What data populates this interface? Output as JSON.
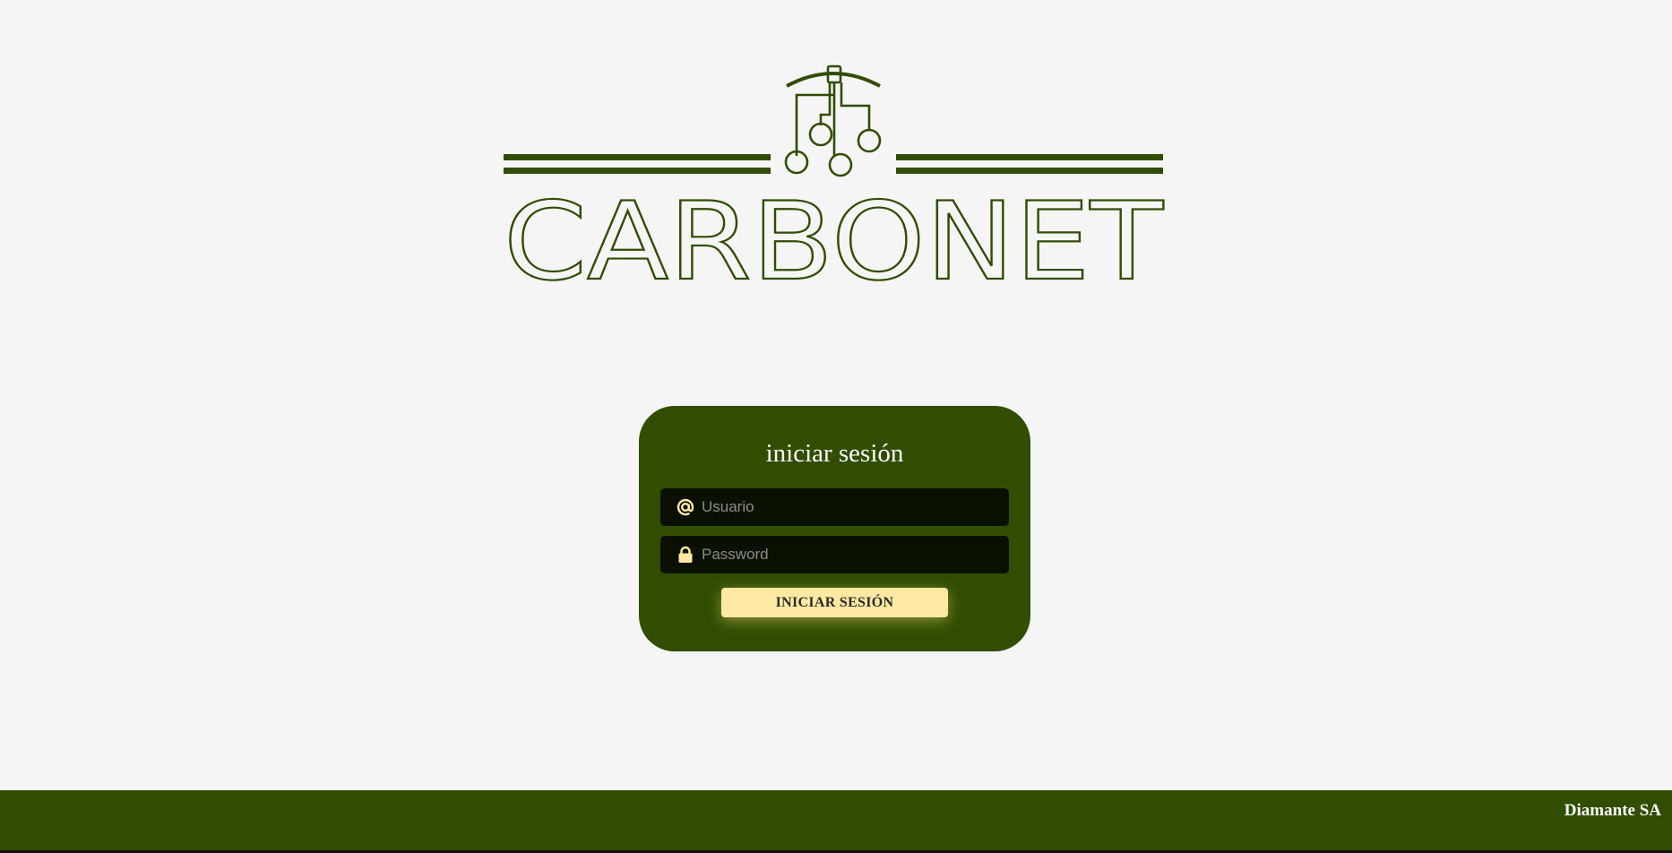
{
  "logo": {
    "wordmark": "CARBONET",
    "icon": "mining-pickaxe-circuit-icon",
    "color": "#304d00"
  },
  "login": {
    "title": "iniciar sesión",
    "username": {
      "icon": "at-sign-icon",
      "placeholder": "Usuario",
      "value": ""
    },
    "password": {
      "icon": "lock-icon",
      "placeholder": "Password",
      "value": ""
    },
    "submit_label": "INICIAR SESIÓN"
  },
  "footer": {
    "brand": "Diamante SA"
  },
  "colors": {
    "primary": "#304d00",
    "accent": "#ffe9a2",
    "background": "#f5f5f5",
    "field": "#0b1102"
  }
}
